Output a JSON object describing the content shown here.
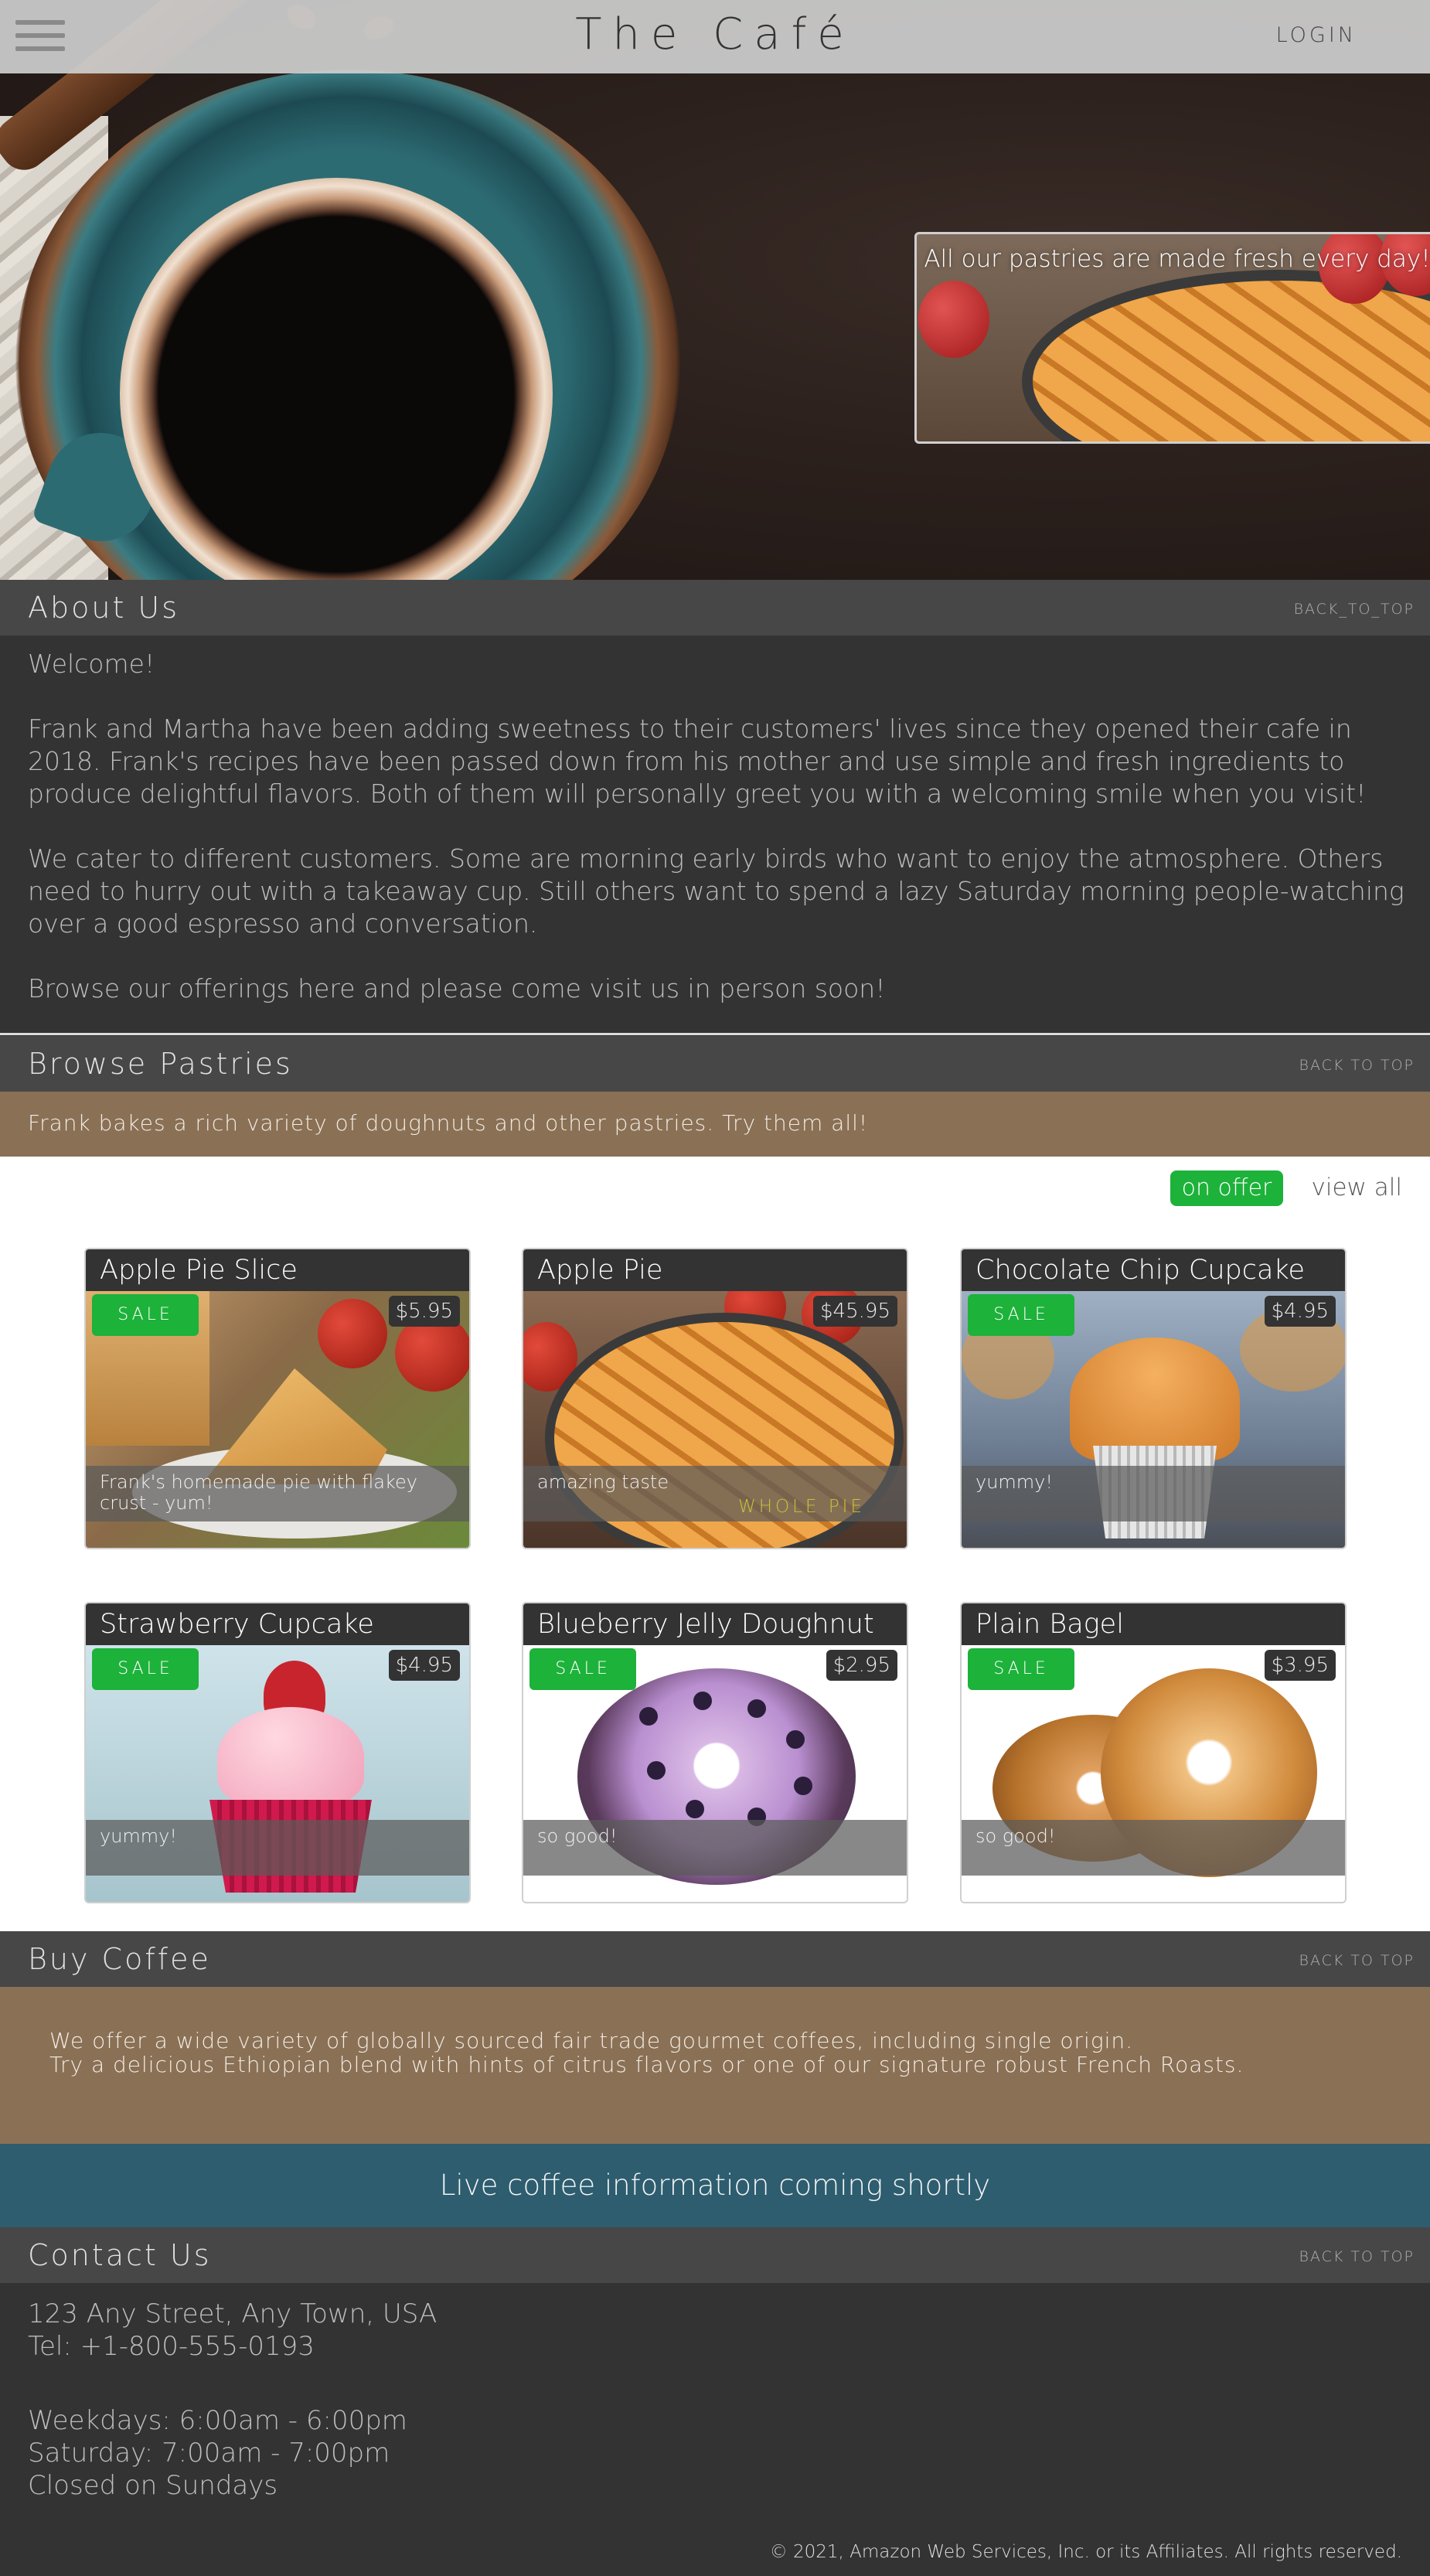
{
  "nav": {
    "brand": "The Café",
    "login": "LOGIN"
  },
  "hero": {
    "caption": "All our pastries are made fresh every day!"
  },
  "about": {
    "title": "About Us",
    "back_to_top": "BACK_TO_TOP",
    "paragraphs": [
      "Welcome!",
      "Frank and Martha have been adding sweetness to their customers' lives since they opened their cafe in 2018. Frank's recipes have been passed down from his mother and use simple and fresh ingredients to produce delightful flavors. Both of them will personally greet you with a welcoming smile when you visit!",
      "We cater to different customers. Some are morning early birds who want to enjoy the atmosphere. Others need to hurry out with a takeaway cup. Still others want to spend a lazy Saturday morning people-watching over a good espresso and conversation.",
      "Browse our offerings here and please come visit us in person soon!"
    ]
  },
  "pastries": {
    "title": "Browse Pastries",
    "back_to_top": "BACK TO TOP",
    "intro": "Frank bakes a rich variety of doughnuts and other pastries. Try them all!",
    "filters": {
      "on_offer": "on offer",
      "view_all": "view all"
    },
    "items": [
      {
        "name": "Apple Pie Slice",
        "price": "$5.95",
        "sale": "SALE",
        "desc": "Frank's homemade pie with flakey crust - yum!",
        "tag": ""
      },
      {
        "name": "Apple Pie",
        "price": "$45.95",
        "sale": "",
        "desc": "amazing taste",
        "tag": "WHOLE PIE"
      },
      {
        "name": "Chocolate Chip Cupcake",
        "price": "$4.95",
        "sale": "SALE",
        "desc": "yummy!",
        "tag": ""
      },
      {
        "name": "Strawberry Cupcake",
        "price": "$4.95",
        "sale": "SALE",
        "desc": "yummy!",
        "tag": ""
      },
      {
        "name": "Blueberry Jelly Doughnut",
        "price": "$2.95",
        "sale": "SALE",
        "desc": "so good!",
        "tag": ""
      },
      {
        "name": "Plain Bagel",
        "price": "$3.95",
        "sale": "SALE",
        "desc": "so good!",
        "tag": ""
      }
    ]
  },
  "coffee": {
    "title": "Buy Coffee",
    "back_to_top": "BACK TO TOP",
    "line1": "We offer a wide variety of globally sourced fair trade gourmet coffees, including single origin.",
    "line2": "Try a delicious Ethiopian blend with hints of citrus flavors or one of our signature robust French Roasts.",
    "live": "Live coffee information coming shortly"
  },
  "contact": {
    "title": "Contact Us",
    "back_to_top": "BACK TO TOP",
    "address": "123 Any Street, Any Town, USA",
    "tel": "Tel: +1-800-555-0193",
    "weekdays": "Weekdays: 6:00am - 6:00pm",
    "saturday": "Saturday: 7:00am - 7:00pm",
    "sunday": "Closed on Sundays"
  },
  "footer": {
    "copyright": "© 2021, Amazon Web Services, Inc. or its Affiliates. All rights reserved."
  },
  "colors": {
    "sale_green": "#1db23a",
    "tan": "#8a7055",
    "teal": "#2d5d6f",
    "header_gray": "#474747",
    "body_gray": "#333333"
  }
}
